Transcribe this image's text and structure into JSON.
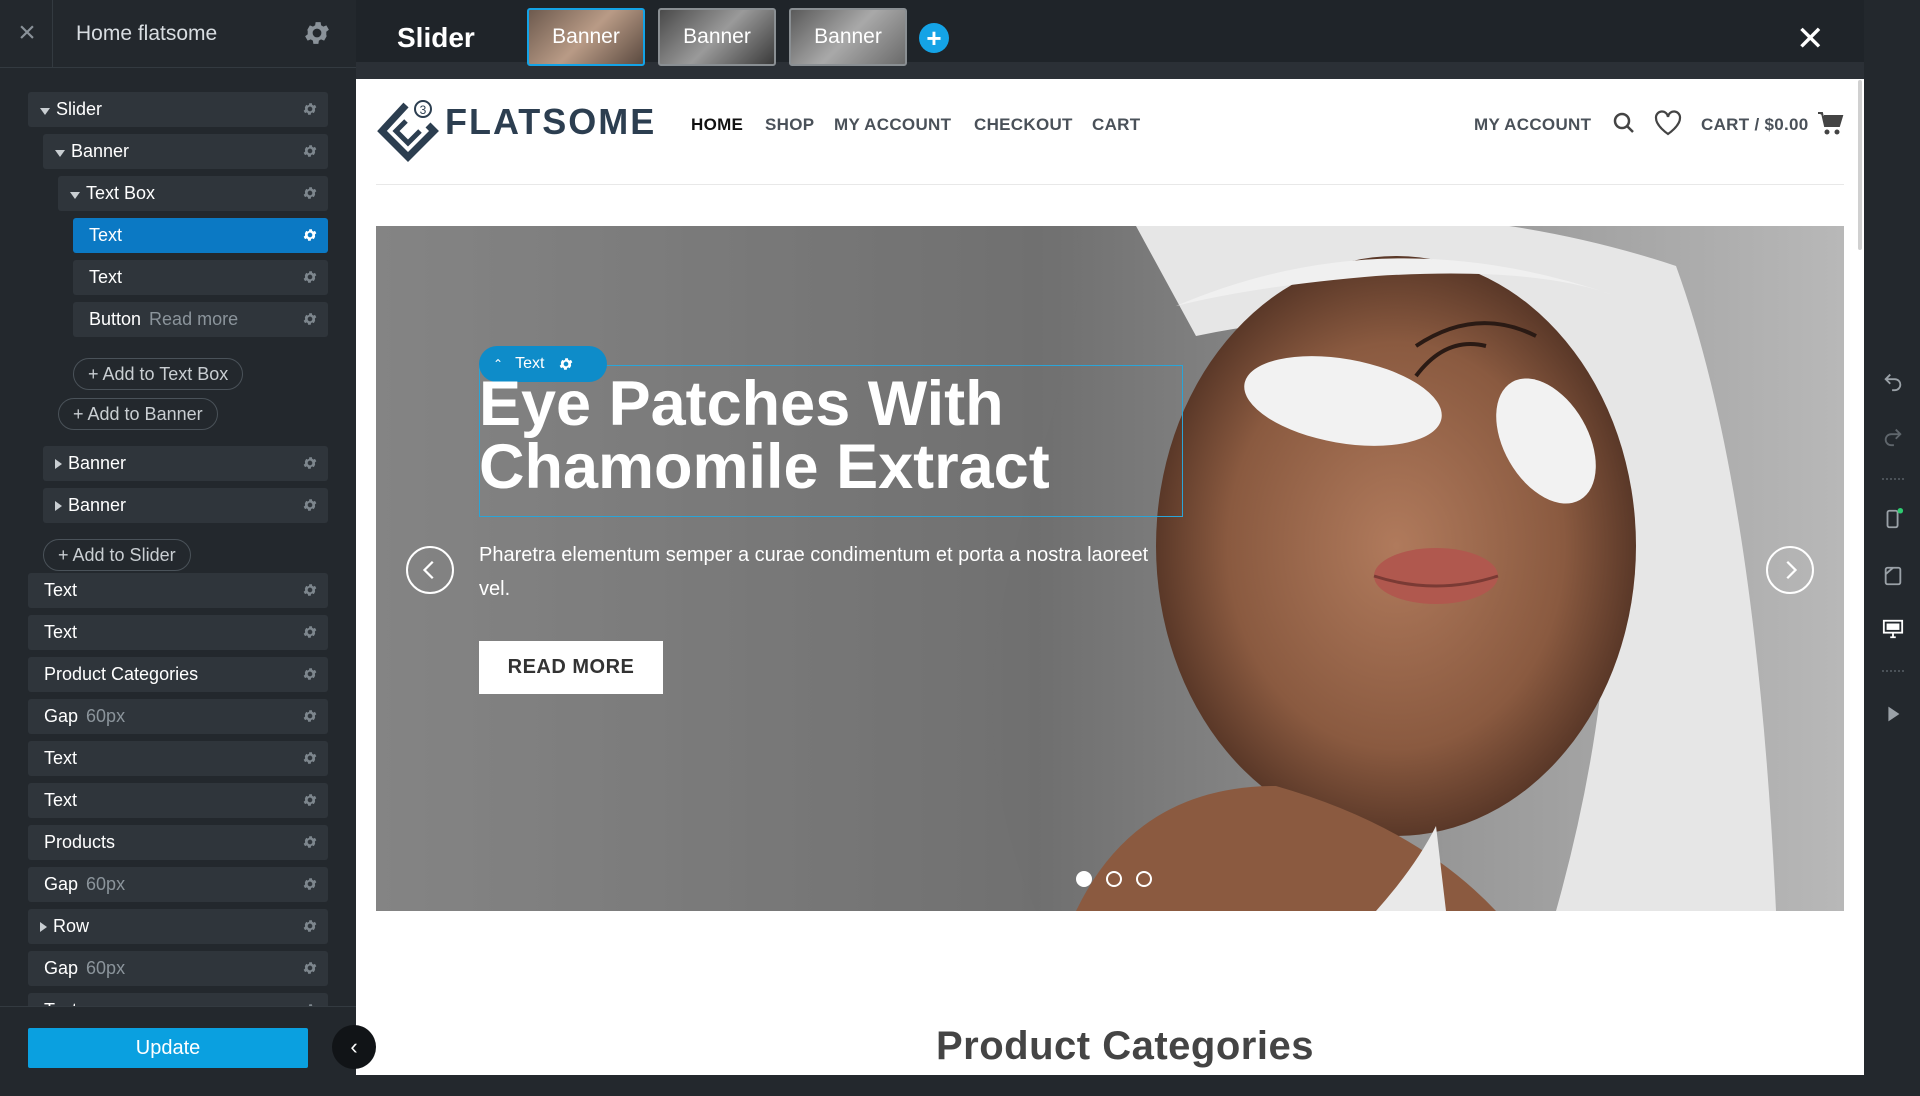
{
  "sidebar": {
    "title": "Home flatsome",
    "update_label": "Update",
    "tree": [
      {
        "label": "Slider",
        "sub": "",
        "caret": "down",
        "indent": 0,
        "selected": false
      },
      {
        "label": "Banner",
        "sub": "",
        "caret": "down",
        "indent": 1,
        "selected": false
      },
      {
        "label": "Text Box",
        "sub": "",
        "caret": "down",
        "indent": 2,
        "selected": false
      },
      {
        "label": "Text",
        "sub": "",
        "caret": "",
        "indent": 3,
        "selected": true
      },
      {
        "label": "Text",
        "sub": "",
        "caret": "",
        "indent": 3,
        "selected": false
      },
      {
        "label": "Button",
        "sub": "Read more",
        "caret": "",
        "indent": 3,
        "selected": false
      },
      {
        "label": "Banner",
        "sub": "",
        "caret": "right",
        "indent": 1,
        "selected": false
      },
      {
        "label": "Banner",
        "sub": "",
        "caret": "right",
        "indent": 1,
        "selected": false
      },
      {
        "label": "Text",
        "sub": "",
        "caret": "",
        "indent": 0,
        "selected": false
      },
      {
        "label": "Text",
        "sub": "",
        "caret": "",
        "indent": 0,
        "selected": false
      },
      {
        "label": "Product Categories",
        "sub": "",
        "caret": "",
        "indent": 0,
        "selected": false
      },
      {
        "label": "Gap",
        "sub": "60px",
        "caret": "",
        "indent": 0,
        "selected": false
      },
      {
        "label": "Text",
        "sub": "",
        "caret": "",
        "indent": 0,
        "selected": false
      },
      {
        "label": "Text",
        "sub": "",
        "caret": "",
        "indent": 0,
        "selected": false
      },
      {
        "label": "Products",
        "sub": "",
        "caret": "",
        "indent": 0,
        "selected": false
      },
      {
        "label": "Gap",
        "sub": "60px",
        "caret": "",
        "indent": 0,
        "selected": false
      },
      {
        "label": "Row",
        "sub": "",
        "caret": "right",
        "indent": 0,
        "selected": false
      },
      {
        "label": "Gap",
        "sub": "60px",
        "caret": "",
        "indent": 0,
        "selected": false
      },
      {
        "label": "Text",
        "sub": "",
        "caret": "",
        "indent": 0,
        "selected": false
      }
    ],
    "add_buttons": [
      "+ Add to Text Box",
      "+ Add to Banner",
      "+ Add to Slider"
    ]
  },
  "topbar": {
    "title": "Slider",
    "thumbs": [
      "Banner",
      "Banner",
      "Banner"
    ]
  },
  "site": {
    "logo_text": "FLATSOME",
    "logo_badge": "3",
    "nav": [
      "HOME",
      "SHOP",
      "MY ACCOUNT",
      "CHECKOUT",
      "CART"
    ],
    "account": "MY ACCOUNT",
    "cart": "CART / $0.00"
  },
  "hero": {
    "tag_label": "Text",
    "heading_line1": "Eye Patches With",
    "heading_line2": "Chamomile Extract",
    "description": "Pharetra elementum semper a curae condimentum et porta a nostra laoreet vel.",
    "button": "READ MORE"
  },
  "section_title": "Product Categories",
  "colors": {
    "accent": "#0b79c4",
    "update": "#0aa0e0",
    "panel": "#23282d",
    "row": "#2f353b"
  }
}
